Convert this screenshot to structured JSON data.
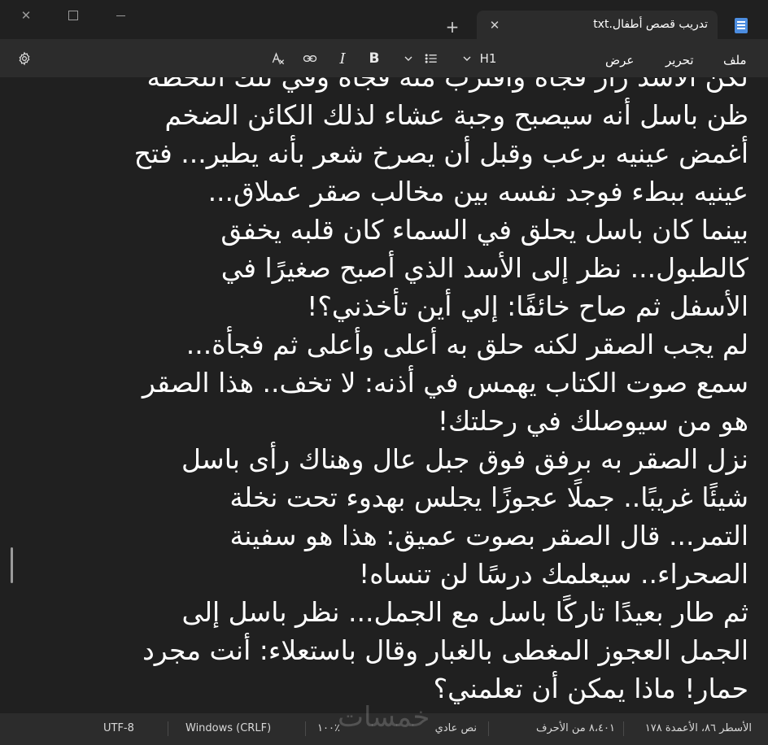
{
  "window": {
    "tab_title": "تدريب قصص أطفال.txt",
    "new_tab_symbol": "+",
    "close_tab_symbol": "✕",
    "close_window_symbol": "✕",
    "app_icon": "notepad-icon"
  },
  "menu": {
    "file": "ملف",
    "edit": "تحرير",
    "view": "عرض"
  },
  "toolbar": {
    "heading_label": "H1",
    "bold_label": "B",
    "italic_label": "I",
    "list_icon": "list-icon",
    "link_icon": "link-icon",
    "clear_format_icon": "clear-formatting-icon",
    "settings_icon": "gear-icon"
  },
  "editor": {
    "lines": [
      "لكن الأسد زار فجأة واقترب منه فجأة وفي تلك اللحظة",
      "ظن باسل أنه سيصبح وجبة عشاء لذلك الكائن الضخم",
      "أغمض عينيه برعب وقبل أن يصرخ شعر بأنه يطير... فتح",
      " عينيه ببطء فوجد نفسه بين مخالب صقر عملاق...",
      "بينما كان باسل يحلق في السماء كان قلبه يخفق",
      "كالطبول... نظر إلى الأسد الذي أصبح صغيرًا في",
      "الأسفل ثم صاح خائفًا: إلي أين تأخذني؟!",
      "لم يجب الصقر لكنه حلق به أعلى وأعلى ثم فجأة...",
      "سمع صوت الكتاب يهمس في أذنه: لا تخف.. هذا الصقر",
      " هو من سيوصلك في رحلتك!",
      "نزل الصقر به برفق فوق جبل عال وهناك رأى باسل",
      "شيئًا غريبًا.. جملًا عجوزًا يجلس بهدوء تحت نخلة",
      "التمر... قال الصقر بصوت عميق: هذا هو سفينة",
      "الصحراء.. سيعلمك درسًا لن تنساه!",
      "ثم طار بعيدًا تاركًا باسل مع الجمل... نظر باسل إلى",
      "الجمل العجوز المغطى بالغبار وقال باستعلاء: أنت مجرد",
      "حمار! ماذا يمكن أن تعلمني؟"
    ]
  },
  "status": {
    "position": "الأسطر ٨٦، الأعمدة ١٧٨",
    "char_count": "٨،٤٠١ من الأحرف",
    "format": "نص عادي",
    "zoom": "١٠٠٪",
    "line_ending": "Windows (CRLF)",
    "encoding": "UTF-8"
  },
  "watermark": "خمسات"
}
